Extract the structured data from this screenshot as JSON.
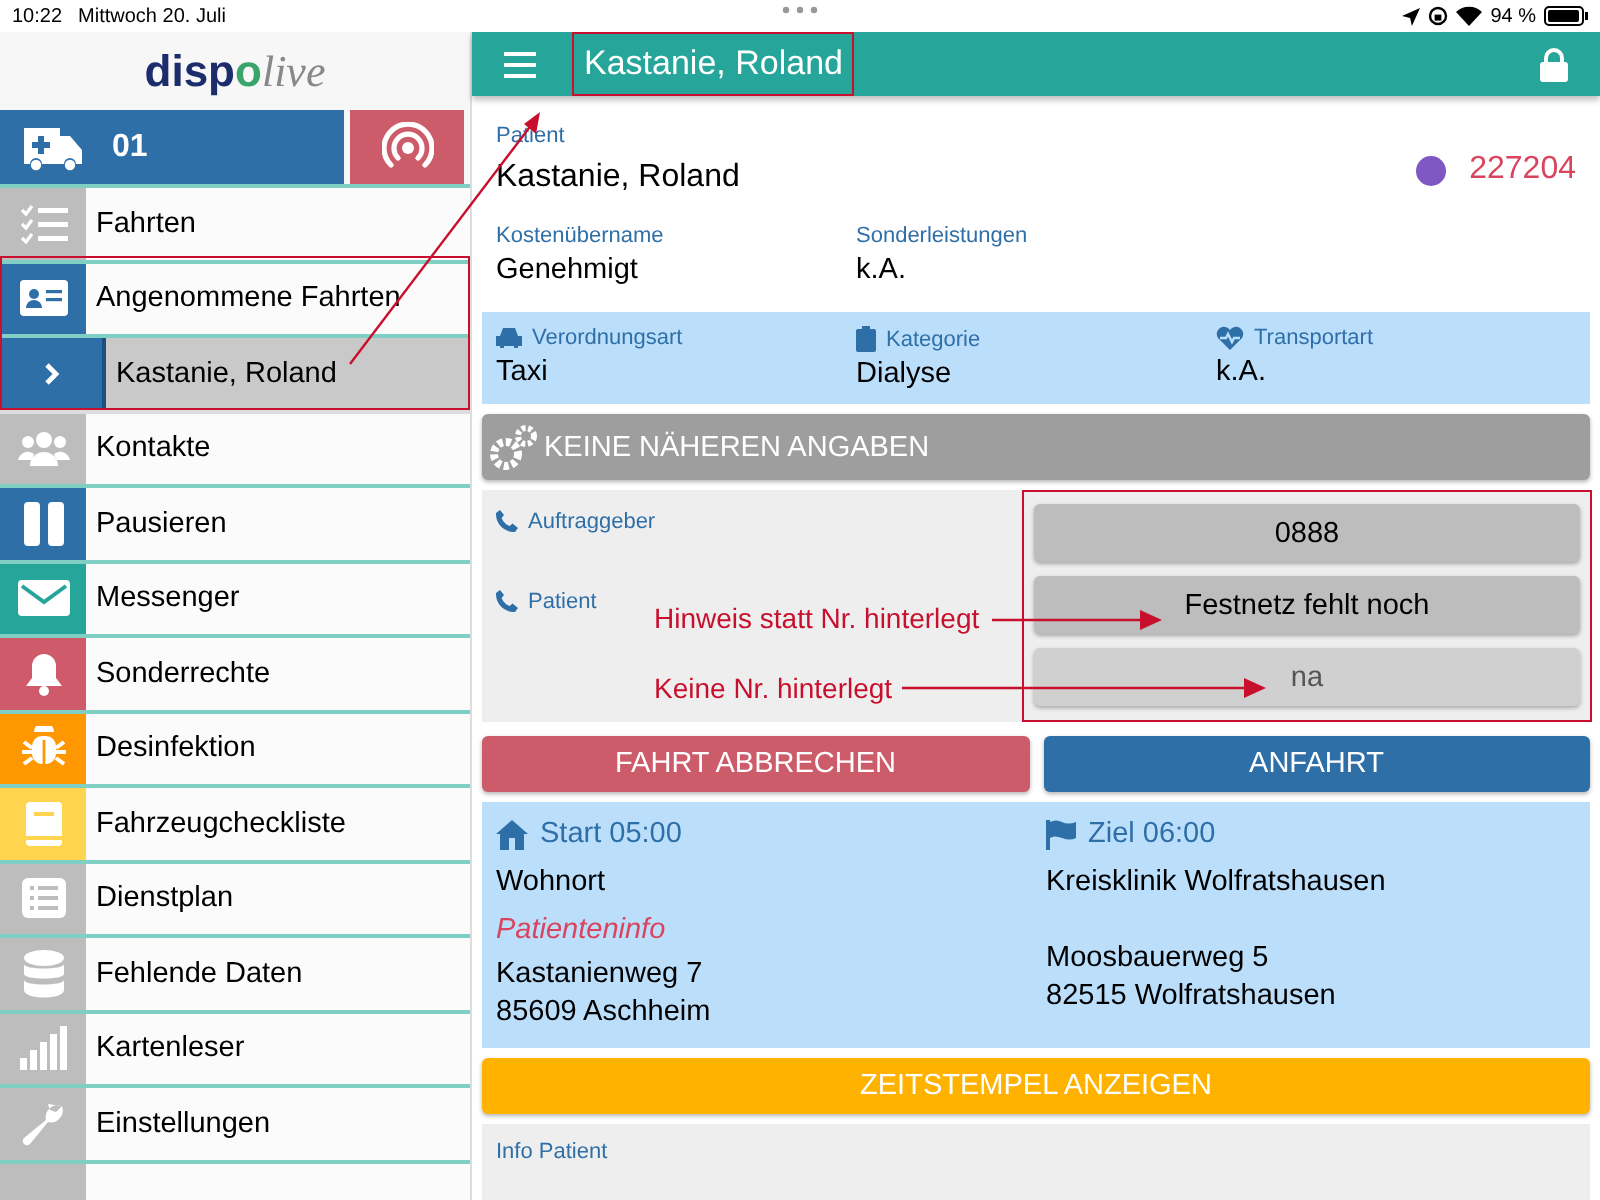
{
  "status_bar": {
    "time": "10:22",
    "date": "Mittwoch 20. Juli",
    "battery": "94 %"
  },
  "sidebar": {
    "logo": [
      "disp",
      "o",
      "live"
    ],
    "vehicle": {
      "number": "01"
    },
    "items": [
      {
        "label": "Fahrten",
        "color": "#bdbdbd",
        "selected": false
      },
      {
        "label": "Angenommene Fahrten",
        "color": "#2f6fa8",
        "selected": false,
        "expanded": true,
        "children": [
          {
            "label": "Kastanie, Roland",
            "selected": true
          }
        ]
      },
      {
        "label": "Kontakte",
        "color": "#bdbdbd",
        "selected": false
      },
      {
        "label": "Pausieren",
        "color": "#2f6fa8",
        "selected": false
      },
      {
        "label": "Messenger",
        "color": "#26a69a",
        "selected": false
      },
      {
        "label": "Sonderrechte",
        "color": "#cf5a6a",
        "selected": false
      },
      {
        "label": "Desinfektion",
        "color": "#ff9800",
        "selected": false
      },
      {
        "label": "Fahrzeugcheckliste",
        "color": "#ffd54f",
        "selected": false
      },
      {
        "label": "Dienstplan",
        "color": "#bdbdbd",
        "selected": false
      },
      {
        "label": "Fehlende Daten",
        "color": "#bdbdbd",
        "selected": false
      },
      {
        "label": "Kartenleser",
        "color": "#bdbdbd",
        "selected": false
      },
      {
        "label": "Einstellungen",
        "color": "#bdbdbd",
        "selected": false
      }
    ]
  },
  "header": {
    "title": "Kastanie, Roland"
  },
  "patient": {
    "label": "Patient",
    "name": "Kastanie, Roland",
    "color": "#7e57c2",
    "number": "227204",
    "fields": [
      {
        "label": "Kostenübername",
        "value": "Genehmigt"
      },
      {
        "label": "Sonderleistungen",
        "value": "k.A."
      }
    ]
  },
  "details": [
    {
      "label": "Verordnungsart",
      "value": "Taxi"
    },
    {
      "label": "Kategorie",
      "value": "Dialyse"
    },
    {
      "label": "Transportart",
      "value": "k.A."
    }
  ],
  "notice": "KEINE NÄHEREN ANGABEN",
  "phones": {
    "labels": [
      "Auftraggeber",
      "Patient"
    ],
    "buttons": [
      {
        "text": "0888",
        "disabled": false
      },
      {
        "text": "Festnetz fehlt noch",
        "disabled": false
      },
      {
        "text": "na",
        "disabled": true
      }
    ]
  },
  "actions": [
    {
      "label": "FAHRT ABBRECHEN",
      "color": "#cd5c6a"
    },
    {
      "label": "ANFAHRT",
      "color": "#2f6fa8"
    }
  ],
  "route": {
    "start": {
      "heading": "Start 05:00",
      "place": "Wohnort",
      "info": "Patienteninfo",
      "street": "Kastanienweg 7",
      "city": "85609 Aschheim"
    },
    "destination": {
      "heading": "Ziel 06:00",
      "place": "Kreisklinik Wolfratshausen",
      "street": "Moosbauerweg 5",
      "city": "82515 Wolfratshausen"
    }
  },
  "timestamp_button": "ZEITSTEMPEL ANZEIGEN",
  "info_patient": {
    "label": "Info Patient"
  },
  "annotations": [
    {
      "text": "Hinweis statt Nr. hinterlegt"
    },
    {
      "text": "Keine Nr. hinterlegt"
    }
  ]
}
